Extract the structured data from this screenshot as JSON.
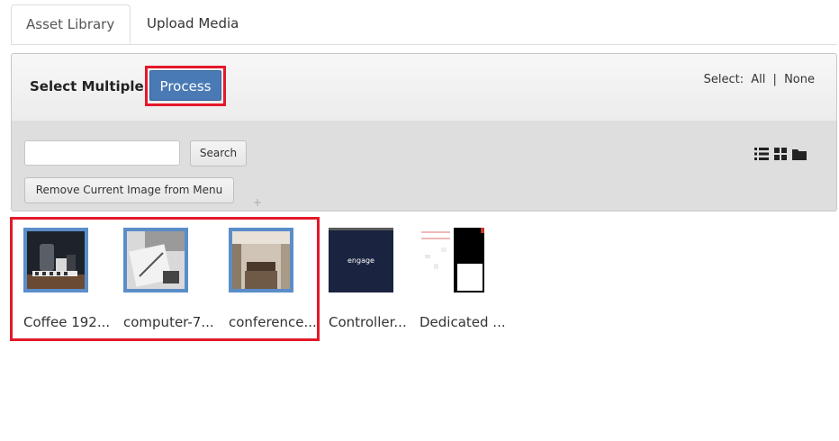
{
  "tabs": [
    {
      "label": "Asset Library",
      "active": true
    },
    {
      "label": "Upload Media",
      "active": false
    }
  ],
  "toolbar": {
    "select_multiple_label": "Select Multiple",
    "process_label": "Process",
    "select_label": "Select:",
    "select_all": "All",
    "separator": "|",
    "select_none": "None"
  },
  "search": {
    "value": "",
    "placeholder": "",
    "button_label": "Search"
  },
  "remove_button_label": "Remove Current Image from Menu",
  "plus_glyph": "+",
  "view_icons": [
    "list-view-icon",
    "grid-view-icon",
    "folder-view-icon"
  ],
  "accent_color": "#4a7ab5",
  "highlight_color": "#e3192a",
  "media": [
    {
      "caption": "Coffee 192...",
      "selected": true
    },
    {
      "caption": "computer-7...",
      "selected": true
    },
    {
      "caption": "conference...",
      "selected": true
    },
    {
      "caption": "Controller...",
      "selected": false,
      "thumb_text": "engage"
    },
    {
      "caption": "Dedicated ...",
      "selected": false
    }
  ]
}
